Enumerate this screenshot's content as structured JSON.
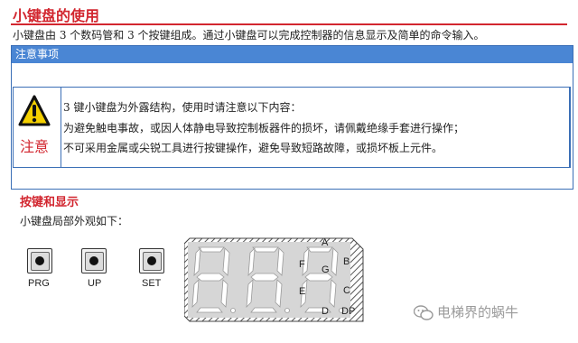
{
  "title": "小键盘的使用",
  "intro": "小键盘由 3 个数码管和 3 个按键组成。通过小键盘可以完成控制器的信息显示及简单的命令输入。",
  "notice": {
    "header": "注意事项",
    "label": "注意",
    "lines": [
      "3 键小键盘为外露结构，使用时请注意以下内容：",
      "为避免触电事故，或因人体静电导致控制板器件的损坏，请佩戴绝缘手套进行操作；",
      "不可采用金属或尖锐工具进行按键操作，避免导致短路故障，或损坏板上元件。"
    ]
  },
  "section": {
    "title": "按键和显示",
    "text": "小键盘局部外观如下："
  },
  "keys": [
    {
      "label": "PRG"
    },
    {
      "label": "UP"
    },
    {
      "label": "SET"
    }
  ],
  "segments": [
    "A",
    "B",
    "C",
    "D",
    "E",
    "F",
    "G",
    "DP"
  ],
  "watermark": "电梯界的蜗牛",
  "colors": {
    "accent": "#d2262f",
    "header": "#4a86d4",
    "border": "#3b6fb6"
  }
}
